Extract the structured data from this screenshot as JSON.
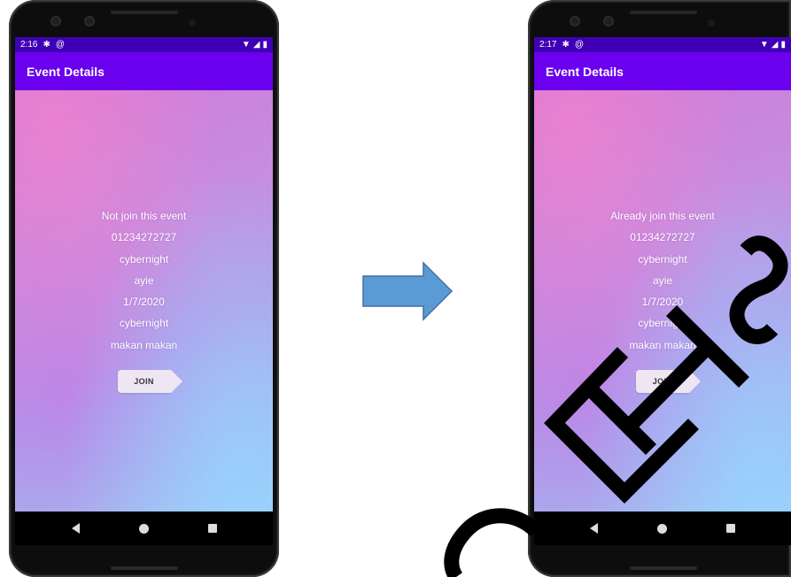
{
  "left_phone": {
    "status_time": "2:16",
    "app_title": "Event Details",
    "status_line": "Not join this event",
    "details": [
      "01234272727",
      "cybernight",
      "ayie",
      "1/7/2020",
      "cybernight",
      "makan makan"
    ],
    "join_label": "JOIN"
  },
  "right_phone": {
    "status_time": "2:17",
    "app_title": "Event Details",
    "status_line": "Already join this event",
    "details": [
      "01234272727",
      "cybernight",
      "ayie",
      "1/7/2020",
      "cybernight",
      "makan makan"
    ],
    "join_label": "JOIN"
  },
  "icons": {
    "status_left": [
      "gear-icon",
      "at-sign-icon"
    ],
    "status_right": [
      "wifi-icon",
      "signal-icon",
      "battery-icon"
    ],
    "nav": [
      "back-icon",
      "home-icon",
      "recents-icon"
    ],
    "transition": "right-arrow-icon"
  },
  "colors": {
    "statusbar": "#3f00b5",
    "appbar": "#6a00ee",
    "arrow_fill": "#5b9bd5",
    "arrow_stroke": "#3f6f9f",
    "watermark": "#000000"
  }
}
